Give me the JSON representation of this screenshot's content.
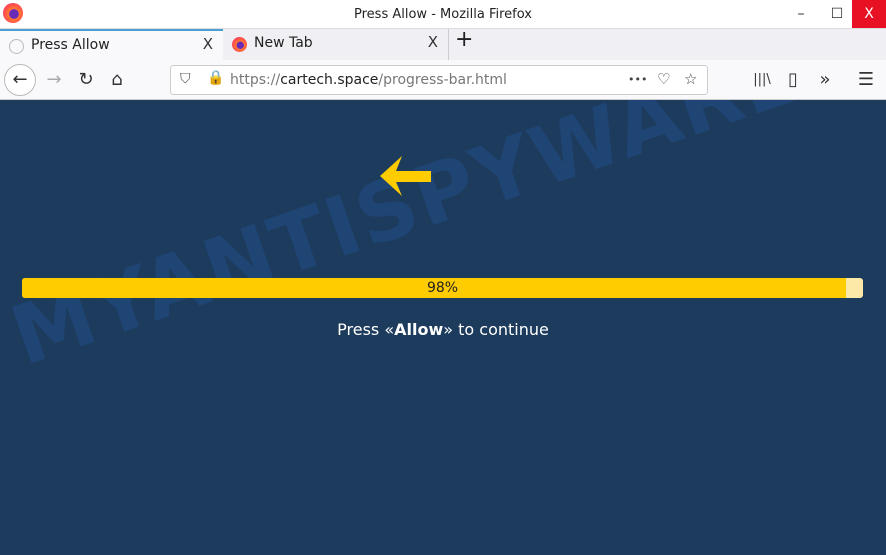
{
  "window": {
    "title": "Press Allow - Mozilla Firefox",
    "minimize": "–",
    "maximize": "☐",
    "close": "X"
  },
  "tabs": [
    {
      "label": "Press Allow",
      "close": "X"
    },
    {
      "label": "New Tab",
      "close": "X"
    }
  ],
  "new_tab": "+",
  "nav": {
    "back": "←",
    "forward": "→",
    "reload": "↻",
    "home": "⌂",
    "url_prefix": "https://",
    "url_domain": "cartech.space",
    "url_path": "/progress-bar.html",
    "more": "•••",
    "pocket": "♡",
    "bookmark": "☆",
    "library": "|||\\",
    "sidebar": "▯",
    "overflow": "»",
    "menu": "☰"
  },
  "page": {
    "progress_percent": 98,
    "progress_label": "98%",
    "msg_before": "Press «",
    "msg_bold": "Allow",
    "msg_after": "» to continue",
    "accent": "#ffcc00",
    "background": "#1d3b5c"
  },
  "watermark": "MYANTISPYWARE.COM"
}
